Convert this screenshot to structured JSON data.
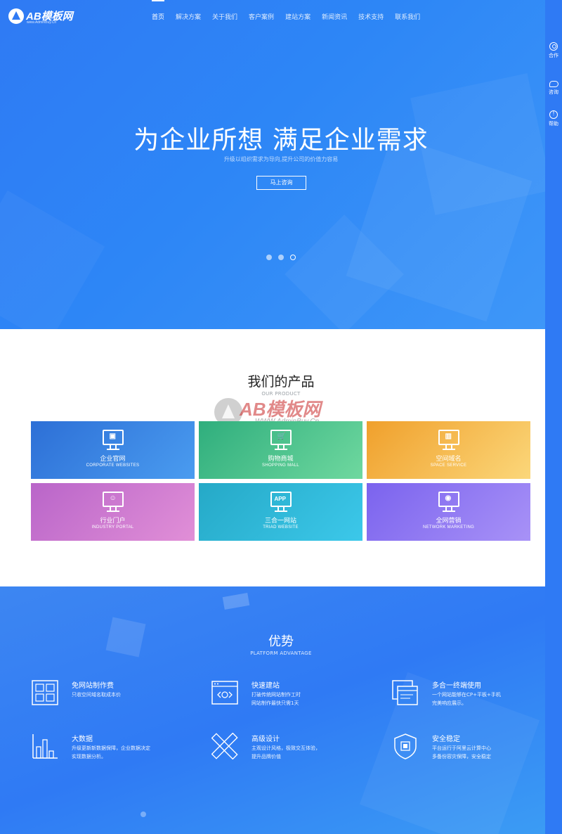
{
  "logo": {
    "text": "AB模板网",
    "sub": "www.AdminBuy.Cn"
  },
  "nav": [
    "首页",
    "解决方案",
    "关于我们",
    "客户案例",
    "建站方案",
    "新闻资讯",
    "技术支持",
    "联系我们"
  ],
  "hero": {
    "title": "为企业所想 满足企业需求",
    "subtitle": "升级以组织需求为导向,提升公司的价值力容易",
    "button": "马上咨询",
    "slides": 3,
    "active_slide": 3
  },
  "sidebar": [
    {
      "label": "合作",
      "icon": "user-icon"
    },
    {
      "label": "咨询",
      "icon": "chat-icon"
    },
    {
      "label": "帮助",
      "icon": "help-icon"
    }
  ],
  "products": {
    "title": "我们的产品",
    "subtitle": "OUR PRODUCT",
    "watermark": {
      "text": "AB模板网",
      "url": "WWW.AdminBuy.Cn"
    },
    "items": [
      {
        "title": "企业官网",
        "en": "CORPORATE WEBSITES",
        "icon": "image-monitor-icon",
        "from": "#2d6fd6",
        "to": "#4a9cf0"
      },
      {
        "title": "购物商城",
        "en": "SHOPPING MALL",
        "icon": "cart-monitor-icon",
        "from": "#2fae7d",
        "to": "#6fd89f"
      },
      {
        "title": "空间域名",
        "en": "SPACE SERVICE",
        "icon": "chart-monitor-icon",
        "from": "#f0a02c",
        "to": "#fbd77a"
      },
      {
        "title": "行业门户",
        "en": "INDUSTRY PORTAL",
        "icon": "group-monitor-icon",
        "from": "#b965c9",
        "to": "#e18fd7"
      },
      {
        "title": "三合一网站",
        "en": "TRIAD WEBSITE",
        "icon": "app-monitor-icon",
        "from": "#25a9c7",
        "to": "#3cc8ea"
      },
      {
        "title": "全网营销",
        "en": "NETWORK MARKETING",
        "icon": "globe-monitor-icon",
        "from": "#7b63ee",
        "to": "#a892f7"
      }
    ],
    "app_label": "APP"
  },
  "advantages": {
    "title": "优势",
    "subtitle": "PLATFORM ADVANTAGE",
    "items": [
      {
        "title": "免网站制作费",
        "desc": "只收空间域名取成本价",
        "icon": "grid-window-icon"
      },
      {
        "title": "快速建站",
        "desc": "打破传统网站制作工时 网站制作最快只需1天",
        "icon": "browser-code-icon"
      },
      {
        "title": "多合一终端使用",
        "desc": "一个网站能够在CP+平板+手机 完美响应展示。",
        "icon": "multi-window-icon"
      },
      {
        "title": "大数据",
        "desc": "升级更新新数据保障，企业数据决定 实现数据分析。",
        "icon": "bar-chart-icon"
      },
      {
        "title": "高级设计",
        "desc": "主观设计风格，极致交互体验， 提升品牌价值",
        "icon": "pencil-ruler-icon"
      },
      {
        "title": "安全稳定",
        "desc": "平台运行于阿里云计算中心 多备份容灾保障，安全稳定",
        "icon": "shield-chip-icon"
      }
    ]
  }
}
